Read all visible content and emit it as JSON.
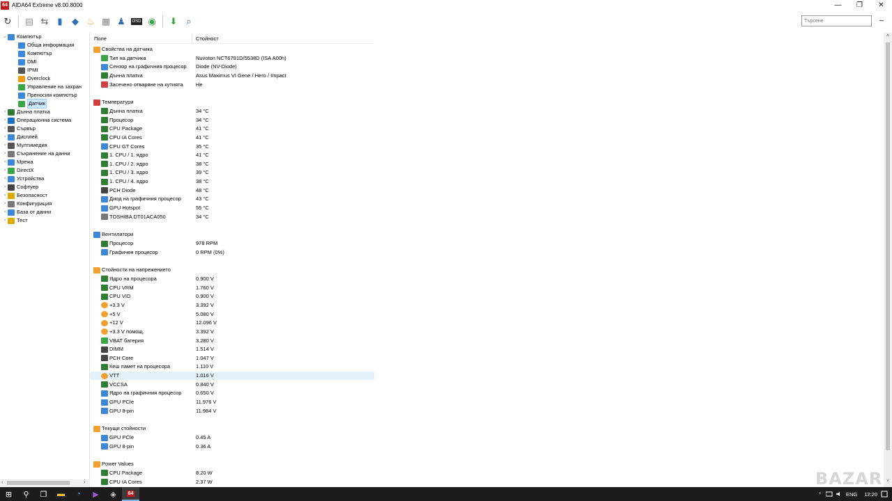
{
  "window": {
    "logo_text": "64",
    "title": "AIDA64 Extreme v8.00.8000",
    "minimize": "—",
    "restore": "❐",
    "close": "✕"
  },
  "search": {
    "placeholder": "Търсене"
  },
  "tree": [
    {
      "label": "Компютър",
      "exp": "⌄",
      "icon": "#3d87d8",
      "level": 0
    },
    {
      "label": "Обща информация",
      "exp": "",
      "icon": "#3d87d8",
      "level": 1
    },
    {
      "label": "Компютър",
      "exp": "",
      "icon": "#3d87d8",
      "level": 1
    },
    {
      "label": "DMI",
      "exp": "",
      "icon": "#3d87d8",
      "level": 1
    },
    {
      "label": "IPMI",
      "exp": "",
      "icon": "#555555",
      "level": 1
    },
    {
      "label": "Overclock",
      "exp": "",
      "icon": "#f39c12",
      "level": 1
    },
    {
      "label": "Управление на захран",
      "exp": "",
      "icon": "#3aa547",
      "level": 1
    },
    {
      "label": "Преносим компютър",
      "exp": "",
      "icon": "#3d87d8",
      "level": 1
    },
    {
      "label": "Датчик",
      "exp": "",
      "icon": "#3aa547",
      "level": 1,
      "selected": true
    },
    {
      "label": "Дънна платка",
      "exp": "›",
      "icon": "#2e7d32",
      "level": 0
    },
    {
      "label": "Операционна система",
      "exp": "›",
      "icon": "#1e6ec8",
      "level": 0
    },
    {
      "label": "Сървър",
      "exp": "›",
      "icon": "#555555",
      "level": 0
    },
    {
      "label": "Дисплей",
      "exp": "›",
      "icon": "#3d87d8",
      "level": 0
    },
    {
      "label": "Мултимедия",
      "exp": "›",
      "icon": "#555555",
      "level": 0
    },
    {
      "label": "Съхранение на данни",
      "exp": "›",
      "icon": "#777777",
      "level": 0
    },
    {
      "label": "Мрежа",
      "exp": "›",
      "icon": "#3d87d8",
      "level": 0
    },
    {
      "label": "DirectX",
      "exp": "›",
      "icon": "#3aa547",
      "level": 0
    },
    {
      "label": "Устройства",
      "exp": "›",
      "icon": "#3d87d8",
      "level": 0
    },
    {
      "label": "Софтуер",
      "exp": "›",
      "icon": "#444444",
      "level": 0
    },
    {
      "label": "Безопасност",
      "exp": "›",
      "icon": "#e0a800",
      "level": 0
    },
    {
      "label": "Конфигурация",
      "exp": "›",
      "icon": "#777777",
      "level": 0
    },
    {
      "label": "База от данни",
      "exp": "›",
      "icon": "#3d87d8",
      "level": 0
    },
    {
      "label": "Тест",
      "exp": "›",
      "icon": "#e0a800",
      "level": 0
    }
  ],
  "columns": {
    "field": "Поле",
    "value": "Стойност"
  },
  "rows": [
    {
      "t": "cat",
      "f": "Свойства на датчика",
      "v": "",
      "icon": "#f0a030"
    },
    {
      "t": "item",
      "f": "Тип на датчика",
      "v": "Nuvoton NCT6791D/5538D  (ISA A00h)",
      "icon": "#3aa547"
    },
    {
      "t": "item",
      "f": "Сензор на графичния процесор",
      "v": "Diode  (NV-Diode)",
      "icon": "#3d87d8"
    },
    {
      "t": "item",
      "f": "Дънна платка",
      "v": "Asus Maximus VI Gene / Hero / Impact",
      "icon": "#2e7d32"
    },
    {
      "t": "item",
      "f": "Засечено отваряне на кутията",
      "v": "Не",
      "icon": "#d04040"
    },
    {
      "t": "gap"
    },
    {
      "t": "cat",
      "f": "Температури",
      "v": "",
      "icon": "#d04040"
    },
    {
      "t": "item",
      "f": "Дънна платка",
      "v": "34 °C",
      "icon": "#2e7d32"
    },
    {
      "t": "item",
      "f": "Процесор",
      "v": "34 °C",
      "icon": "#2e7d32"
    },
    {
      "t": "item",
      "f": "CPU Package",
      "v": "41 °C",
      "icon": "#2e7d32"
    },
    {
      "t": "item",
      "f": "CPU IA Cores",
      "v": "41 °C",
      "icon": "#2e7d32"
    },
    {
      "t": "item",
      "f": "CPU GT Cores",
      "v": "35 °C",
      "icon": "#3d87d8"
    },
    {
      "t": "item",
      "f": "1. CPU / 1. ядро",
      "v": "41 °C",
      "icon": "#2e7d32"
    },
    {
      "t": "item",
      "f": "1. CPU / 2. ядро",
      "v": "38 °C",
      "icon": "#2e7d32"
    },
    {
      "t": "item",
      "f": "1. CPU / 3. ядро",
      "v": "39 °C",
      "icon": "#2e7d32"
    },
    {
      "t": "item",
      "f": "1. CPU / 4. ядро",
      "v": "38 °C",
      "icon": "#2e7d32"
    },
    {
      "t": "item",
      "f": "PCH Diode",
      "v": "48 °C",
      "icon": "#444444"
    },
    {
      "t": "item",
      "f": "Диод на графичния процесор",
      "v": "43 °C",
      "icon": "#3d87d8"
    },
    {
      "t": "item",
      "f": "GPU Hotspot",
      "v": "55 °C",
      "icon": "#3d87d8"
    },
    {
      "t": "item",
      "f": "TOSHIBA DT01ACA050",
      "v": "34 °C",
      "icon": "#777777"
    },
    {
      "t": "gap"
    },
    {
      "t": "cat",
      "f": "Вентилатори",
      "v": "",
      "icon": "#3d87d8"
    },
    {
      "t": "item",
      "f": "Процесор",
      "v": "978 RPM",
      "icon": "#2e7d32"
    },
    {
      "t": "item",
      "f": "Графичен процесор",
      "v": "0 RPM  (0%)",
      "icon": "#3d87d8"
    },
    {
      "t": "gap"
    },
    {
      "t": "cat",
      "f": "Стойности на напрежението",
      "v": "",
      "icon": "#f0a030"
    },
    {
      "t": "item",
      "f": "Ядро на процесора",
      "v": "0.900 V",
      "icon": "#2e7d32"
    },
    {
      "t": "item",
      "f": "CPU VRM",
      "v": "1.760 V",
      "icon": "#2e7d32"
    },
    {
      "t": "item",
      "f": "CPU VID",
      "v": "0.900 V",
      "icon": "#2e7d32"
    },
    {
      "t": "item",
      "f": "+3.3 V",
      "v": "3.392 V",
      "icon": "#f0a030"
    },
    {
      "t": "item",
      "f": "+5 V",
      "v": "5.080 V",
      "icon": "#f0a030"
    },
    {
      "t": "item",
      "f": "+12 V",
      "v": "12.096 V",
      "icon": "#f0a030"
    },
    {
      "t": "item",
      "f": "+3.3 V помощ.",
      "v": "3.392 V",
      "icon": "#f0a030"
    },
    {
      "t": "item",
      "f": "VBAT батерия",
      "v": "3.280 V",
      "icon": "#3aa547"
    },
    {
      "t": "item",
      "f": "DIMM",
      "v": "1.514 V",
      "icon": "#444444"
    },
    {
      "t": "item",
      "f": "PCH Core",
      "v": "1.047 V",
      "icon": "#444444"
    },
    {
      "t": "item",
      "f": "Кеш памет на процесора",
      "v": "1.110 V",
      "icon": "#2e7d32"
    },
    {
      "t": "item",
      "f": "VTT",
      "v": "1.016 V",
      "icon": "#f0a030",
      "hl": true
    },
    {
      "t": "item",
      "f": "VCCSA",
      "v": "0.840 V",
      "icon": "#2e7d32"
    },
    {
      "t": "item",
      "f": "Ядро на графичния процесор",
      "v": "0.650 V",
      "icon": "#3d87d8"
    },
    {
      "t": "item",
      "f": "GPU PCIe",
      "v": "11.976 V",
      "icon": "#3d87d8"
    },
    {
      "t": "item",
      "f": "GPU 8-pin",
      "v": "11.984 V",
      "icon": "#3d87d8"
    },
    {
      "t": "gap"
    },
    {
      "t": "cat",
      "f": "Текущи стойности",
      "v": "",
      "icon": "#f0a030"
    },
    {
      "t": "item",
      "f": "GPU PCIe",
      "v": "0.45 A",
      "icon": "#3d87d8"
    },
    {
      "t": "item",
      "f": "GPU 8-pin",
      "v": "0.36 A",
      "icon": "#3d87d8"
    },
    {
      "t": "gap"
    },
    {
      "t": "cat",
      "f": "Power Values",
      "v": "",
      "icon": "#f0a030"
    },
    {
      "t": "item",
      "f": "CPU Package",
      "v": "8.20 W",
      "icon": "#2e7d32"
    },
    {
      "t": "item",
      "f": "CPU IA Cores",
      "v": "2.37 W",
      "icon": "#2e7d32"
    }
  ],
  "toolbar_icons": [
    {
      "name": "refresh-icon",
      "color": "#333333",
      "glyph": "↻"
    },
    {
      "name": "report-icon",
      "color": "#999999",
      "glyph": "▤"
    },
    {
      "name": "network-icon",
      "color": "#666666",
      "glyph": "⇆"
    },
    {
      "name": "monitor-icon",
      "color": "#2f6fb5",
      "glyph": "▮"
    },
    {
      "name": "motherboard-icon",
      "color": "#2f6fb5",
      "glyph": "◆"
    },
    {
      "name": "flame-icon",
      "color": "#f0a030",
      "glyph": "♨"
    },
    {
      "name": "memory-icon",
      "color": "#888888",
      "glyph": "▦"
    },
    {
      "name": "user-icon",
      "color": "#2f6fb5",
      "glyph": "♟"
    },
    {
      "name": "osd-icon",
      "color": "#222222",
      "glyph": "OSD"
    },
    {
      "name": "sensor-icon",
      "color": "#3aa547",
      "glyph": "◉"
    },
    {
      "name": "download-icon",
      "color": "#3aa547",
      "glyph": "⬇"
    },
    {
      "name": "search-icon",
      "color": "#2f6fb5",
      "glyph": "⌕"
    }
  ],
  "taskbar": {
    "apps": [
      {
        "name": "start-icon",
        "glyph": "⊞",
        "color": "#ffffff"
      },
      {
        "name": "taskbar-search-icon",
        "glyph": "⚲",
        "color": "#ffffff"
      },
      {
        "name": "task-view-icon",
        "glyph": "❐",
        "color": "#ffffff"
      },
      {
        "name": "file-explorer-icon",
        "glyph": "▬",
        "color": "#f3c13a"
      },
      {
        "name": "edge-icon",
        "glyph": "◔",
        "color": "#36a3e8"
      },
      {
        "name": "visual-studio-icon",
        "glyph": "▶",
        "color": "#9b59d0"
      },
      {
        "name": "app-icon",
        "glyph": "◈",
        "color": "#cccccc"
      },
      {
        "name": "aida64-taskbar-icon",
        "glyph": "64",
        "color": "#ffffff",
        "active": true
      }
    ],
    "tray_arrow": "⌃",
    "language": "ENG",
    "clock": "12:20"
  },
  "watermark": "BAZAR"
}
